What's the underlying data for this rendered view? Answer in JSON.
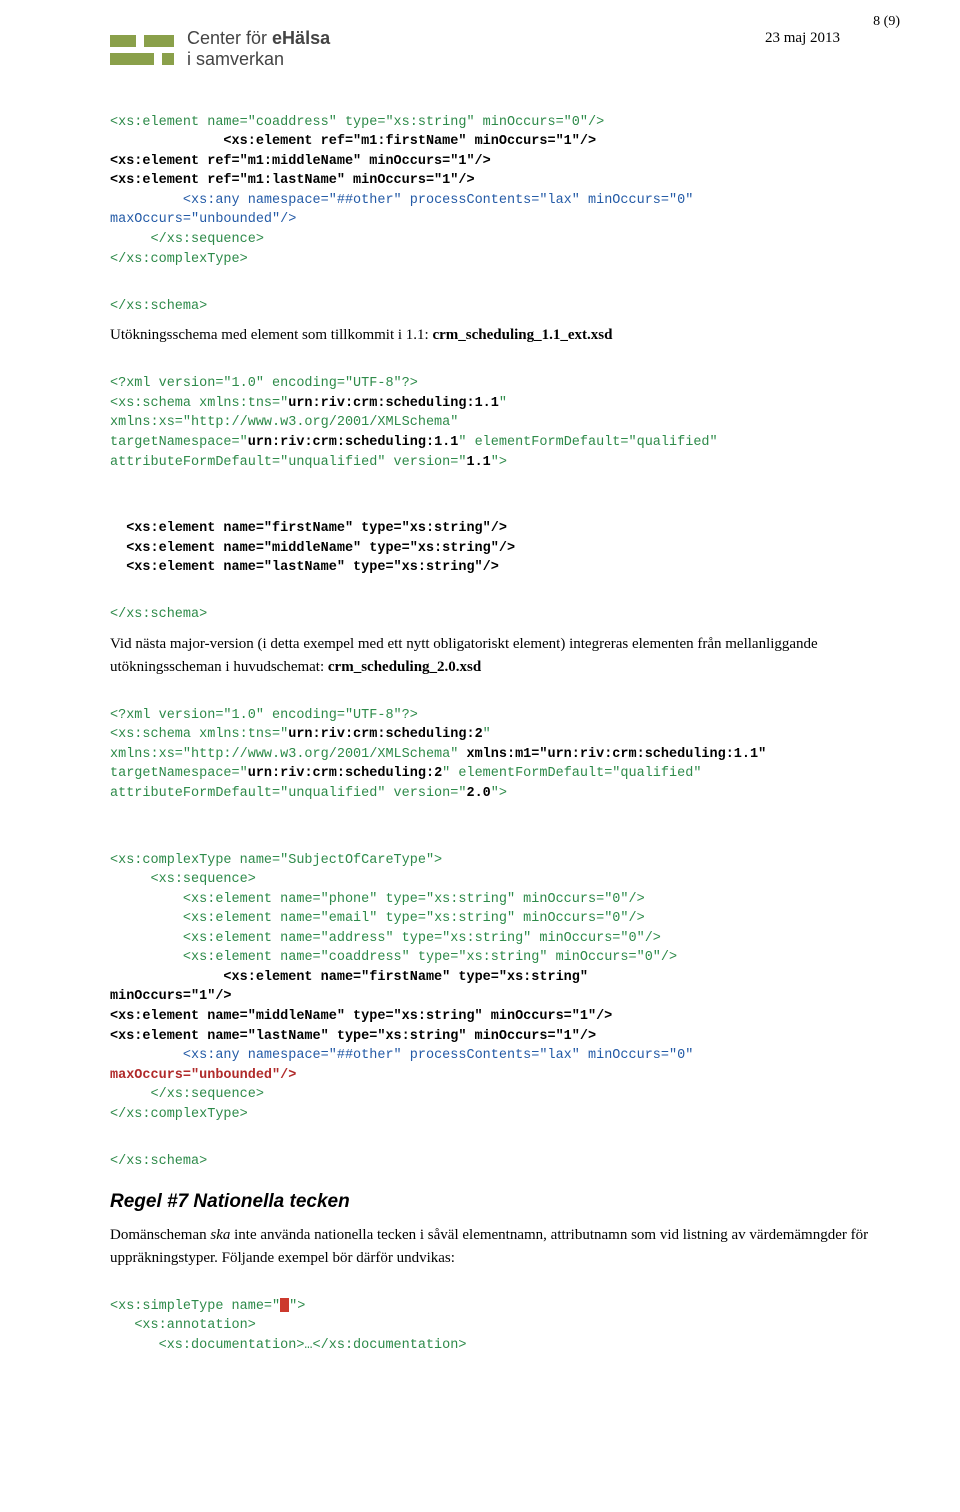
{
  "page": {
    "num": "8 (9)",
    "date": "23 maj 2013"
  },
  "logo": {
    "line1a": "Center för ",
    "line1b": "eHälsa",
    "line2": "i samverkan"
  },
  "block1": {
    "l1": "<xs:element name=\"coaddress\" type=\"xs:string\" minOccurs=\"0\"/>",
    "l2a": "              ",
    "l2b": "<xs:element ref=\"m1:firstName\" minOccurs=\"1\"/>",
    "l3": "<xs:element ref=\"m1:middleName\" minOccurs=\"1\"/>",
    "l4": "<xs:element ref=\"m1:lastName\" minOccurs=\"1\"/>",
    "l5a": "         ",
    "l5b": "<xs:any namespace=\"##other\" processContents=\"lax\" minOccurs=\"0\"",
    "l6": "maxOccurs=\"unbounded\"/>",
    "l7": "     </xs:sequence>",
    "l8": "</xs:complexType>",
    "l9": "</xs:schema>"
  },
  "para1a": "Utökningsschema med element som tillkommit i 1.1: ",
  "para1b": "crm_scheduling_1.1_ext.xsd",
  "block2": {
    "l1": "<?xml version=\"1.0\" encoding=\"UTF-8\"?>",
    "l2a": "<xs:schema xmlns:tns=\"",
    "l2b": "urn:riv:crm:scheduling:1.1",
    "l2c": "\"",
    "l3": "xmlns:xs=\"http://www.w3.org/2001/XMLSchema\"",
    "l4a": "targetNamespace=\"",
    "l4b": "urn:riv:crm:scheduling:1.1",
    "l4c": "\" elementFormDefault=\"qualified\"",
    "l5a": "attributeFormDefault=\"unqualified\" version=\"",
    "l5b": "1.1",
    "l5c": "\">"
  },
  "block2b": {
    "l1": "  <xs:element name=\"firstName\" type=\"xs:string\"/>",
    "l2": "  <xs:element name=\"middleName\" type=\"xs:string\"/>",
    "l3": "  <xs:element name=\"lastName\" type=\"xs:string\"/>"
  },
  "block2c": "</xs:schema>",
  "para2a": "Vid nästa major-version (i detta exempel med ett nytt obligatoriskt element) integreras elementen från mellanliggande utökningsscheman i huvudschemat: ",
  "para2b": "crm_scheduling_2.0.xsd",
  "block3": {
    "l1": "<?xml version=\"1.0\" encoding=\"UTF-8\"?>",
    "l2a": "<xs:schema xmlns:tns=\"",
    "l2b": "urn:riv:crm:scheduling:2",
    "l2c": "\"",
    "l3a": "xmlns:xs=\"http://www.w3.org/2001/XMLSchema\" ",
    "l3b": "xmlns:m1=\"urn:riv:crm:scheduling:1.1\"",
    "l4a": "targetNamespace=\"",
    "l4b": "urn:riv:crm:scheduling:2",
    "l4c": "\" elementFormDefault=\"qualified\"",
    "l5a": "attributeFormDefault=\"unqualified\" version=\"",
    "l5b": "2.0",
    "l5c": "\">"
  },
  "block4": {
    "l1": "<xs:complexType name=\"SubjectOfCareType\">",
    "l2": "     <xs:sequence>",
    "l3": "         <xs:element name=\"phone\" type=\"xs:string\" minOccurs=\"0\"/>",
    "l4": "         <xs:element name=\"email\" type=\"xs:string\" minOccurs=\"0\"/>",
    "l5": "         <xs:element name=\"address\" type=\"xs:string\" minOccurs=\"0\"/>",
    "l6": "         <xs:element name=\"coaddress\" type=\"xs:string\" minOccurs=\"0\"/>"
  },
  "block4b": {
    "l1": "              <xs:element name=\"firstName\" type=\"xs:string\"",
    "l2": "minOccurs=\"1\"/>",
    "l3": "<xs:element name=\"middleName\" type=\"xs:string\" minOccurs=\"1\"/>",
    "l4": "<xs:element name=\"lastName\" type=\"xs:string\" minOccurs=\"1\"/>"
  },
  "block4c": {
    "l1a": "         ",
    "l1b": "<xs:any namespace=\"##other\" processContents=\"lax\" minOccurs=\"0\"",
    "l2a": "maxOccurs=\"unbounded\"/>",
    "l3": "     </xs:sequence>",
    "l4": "</xs:complexType>",
    "l5": "</xs:schema>"
  },
  "rule7": {
    "heading": "Regel #7 Nationella tecken",
    "p1": "Domänscheman ",
    "p2": "ska",
    "p3": " inte använda nationella tecken i såväl elementnamn, attributnamn som vid listning av värdemämngder för uppräkningstyper. Följande exempel bör därför undvikas:"
  },
  "blockR": {
    "l1a": "<xs:simpleType name=\"",
    "l1b": "\">",
    "l2": "   <xs:annotation>",
    "l3": "      <xs:documentation>…</xs:documentation>"
  }
}
